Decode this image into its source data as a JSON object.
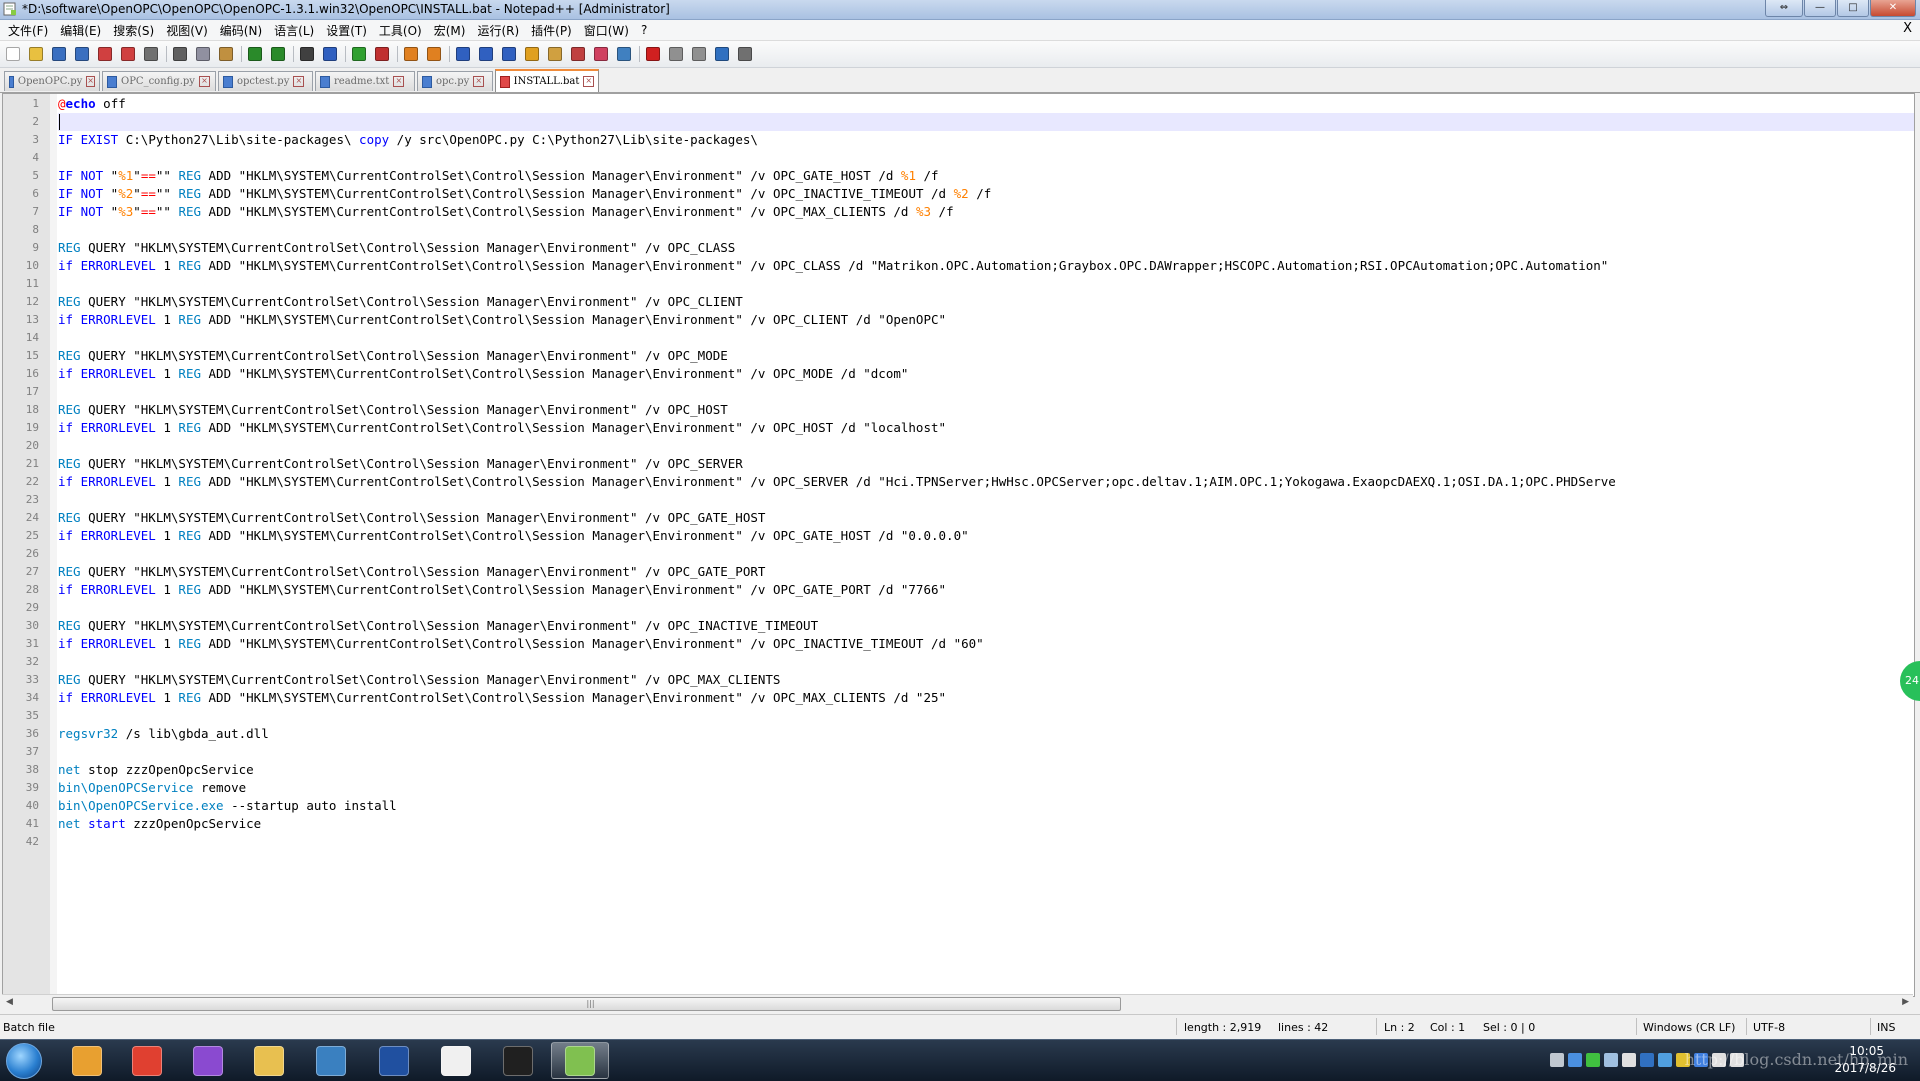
{
  "window": {
    "title": "*D:\\software\\OpenOPC\\OpenOPC\\OpenOPC-1.3.1.win32\\OpenOPC\\INSTALL.bat - Notepad++ [Administrator]",
    "app_icon": "notepad-plus-plus-icon",
    "controls": {
      "extra": "⇔",
      "minimize": "—",
      "maximize": "□",
      "close": "✕"
    }
  },
  "menu": {
    "items": [
      "文件(F)",
      "编辑(E)",
      "搜索(S)",
      "视图(V)",
      "编码(N)",
      "语言(L)",
      "设置(T)",
      "工具(O)",
      "宏(M)",
      "运行(R)",
      "插件(P)",
      "窗口(W)",
      "?"
    ],
    "close": "X"
  },
  "toolbar": {
    "buttons": [
      {
        "name": "new-file-icon",
        "color": "#ffffff"
      },
      {
        "name": "open-file-icon",
        "color": "#e8c040"
      },
      {
        "name": "save-icon",
        "color": "#3a6fc0"
      },
      {
        "name": "save-all-icon",
        "color": "#3a6fc0"
      },
      {
        "name": "close-icon",
        "color": "#d04040"
      },
      {
        "name": "close-all-icon",
        "color": "#d04040"
      },
      {
        "name": "print-icon",
        "color": "#707070"
      },
      {
        "name": "cut-icon",
        "color": "#606060"
      },
      {
        "name": "copy-icon",
        "color": "#9090a0"
      },
      {
        "name": "paste-icon",
        "color": "#c09040"
      },
      {
        "name": "undo-icon",
        "color": "#2a8a2a"
      },
      {
        "name": "redo-icon",
        "color": "#2a8a2a"
      },
      {
        "name": "find-icon",
        "color": "#404040"
      },
      {
        "name": "replace-icon",
        "color": "#3060c0"
      },
      {
        "name": "zoom-in-icon",
        "color": "#30a030"
      },
      {
        "name": "zoom-out-icon",
        "color": "#c03030"
      },
      {
        "name": "sync-vertical-icon",
        "color": "#e08020"
      },
      {
        "name": "sync-horizontal-icon",
        "color": "#e08020"
      },
      {
        "name": "word-wrap-icon",
        "color": "#3060c0"
      },
      {
        "name": "show-all-chars-icon",
        "color": "#3060c0"
      },
      {
        "name": "indent-guide-icon",
        "color": "#3060c0"
      },
      {
        "name": "user-language-icon",
        "color": "#e0a020"
      },
      {
        "name": "document-map-icon",
        "color": "#d0a040"
      },
      {
        "name": "function-list-icon",
        "color": "#c04040"
      },
      {
        "name": "folder-workspace-icon",
        "color": "#d04060"
      },
      {
        "name": "monitoring-icon",
        "color": "#4080c0"
      },
      {
        "name": "record-macro-icon",
        "color": "#d02020"
      },
      {
        "name": "stop-macro-icon",
        "color": "#909090"
      },
      {
        "name": "play-macro-icon",
        "color": "#909090"
      },
      {
        "name": "play-macro-multiple-icon",
        "color": "#3070c0"
      },
      {
        "name": "save-macro-icon",
        "color": "#707070"
      }
    ]
  },
  "tabs": [
    {
      "label": "OpenOPC.py",
      "active": false
    },
    {
      "label": "OPC_config.py",
      "active": false
    },
    {
      "label": "opctest.py",
      "active": false
    },
    {
      "label": "readme.txt",
      "active": false
    },
    {
      "label": "opc.py",
      "active": false
    },
    {
      "label": "INSTALL.bat",
      "active": true
    }
  ],
  "editor": {
    "current_line": 2,
    "lines": [
      [
        [
          "o",
          "@"
        ],
        [
          "kb",
          "echo"
        ],
        [
          "n",
          " off"
        ]
      ],
      [],
      [
        [
          "k",
          "IF EXIST"
        ],
        [
          "n",
          " C:\\Python27\\Lib\\site-packages\\ "
        ],
        [
          "k",
          "copy"
        ],
        [
          "n",
          " /y src\\OpenOPC.py C:\\Python27\\Lib\\site-packages\\"
        ]
      ],
      [],
      [
        [
          "k",
          "IF NOT"
        ],
        [
          "n",
          " \""
        ],
        [
          "v",
          "%1"
        ],
        [
          "n",
          "\""
        ],
        [
          "o",
          "=="
        ],
        [
          "n",
          "\"\" "
        ],
        [
          "c",
          "REG"
        ],
        [
          "n",
          " ADD \"HKLM\\SYSTEM\\CurrentControlSet\\Control\\Session Manager\\Environment\" /v OPC_GATE_HOST /d "
        ],
        [
          "v",
          "%1"
        ],
        [
          "n",
          " /f"
        ]
      ],
      [
        [
          "k",
          "IF NOT"
        ],
        [
          "n",
          " \""
        ],
        [
          "v",
          "%2"
        ],
        [
          "n",
          "\""
        ],
        [
          "o",
          "=="
        ],
        [
          "n",
          "\"\" "
        ],
        [
          "c",
          "REG"
        ],
        [
          "n",
          " ADD \"HKLM\\SYSTEM\\CurrentControlSet\\Control\\Session Manager\\Environment\" /v OPC_INACTIVE_TIMEOUT /d "
        ],
        [
          "v",
          "%2"
        ],
        [
          "n",
          " /f"
        ]
      ],
      [
        [
          "k",
          "IF NOT"
        ],
        [
          "n",
          " \""
        ],
        [
          "v",
          "%3"
        ],
        [
          "n",
          "\""
        ],
        [
          "o",
          "=="
        ],
        [
          "n",
          "\"\" "
        ],
        [
          "c",
          "REG"
        ],
        [
          "n",
          " ADD \"HKLM\\SYSTEM\\CurrentControlSet\\Control\\Session Manager\\Environment\" /v OPC_MAX_CLIENTS /d "
        ],
        [
          "v",
          "%3"
        ],
        [
          "n",
          " /f"
        ]
      ],
      [],
      [
        [
          "c",
          "REG"
        ],
        [
          "n",
          " QUERY \"HKLM\\SYSTEM\\CurrentControlSet\\Control\\Session Manager\\Environment\" /v OPC_CLASS"
        ]
      ],
      [
        [
          "k",
          "if ERRORLEVEL"
        ],
        [
          "n",
          " 1 "
        ],
        [
          "c",
          "REG"
        ],
        [
          "n",
          " ADD \"HKLM\\SYSTEM\\CurrentControlSet\\Control\\Session Manager\\Environment\" /v OPC_CLASS /d \"Matrikon.OPC.Automation;Graybox.OPC.DAWrapper;HSCOPC.Automation;RSI.OPCAutomation;OPC.Automation\""
        ]
      ],
      [],
      [
        [
          "c",
          "REG"
        ],
        [
          "n",
          " QUERY \"HKLM\\SYSTEM\\CurrentControlSet\\Control\\Session Manager\\Environment\" /v OPC_CLIENT"
        ]
      ],
      [
        [
          "k",
          "if ERRORLEVEL"
        ],
        [
          "n",
          " 1 "
        ],
        [
          "c",
          "REG"
        ],
        [
          "n",
          " ADD \"HKLM\\SYSTEM\\CurrentControlSet\\Control\\Session Manager\\Environment\" /v OPC_CLIENT /d \"OpenOPC\""
        ]
      ],
      [],
      [
        [
          "c",
          "REG"
        ],
        [
          "n",
          " QUERY \"HKLM\\SYSTEM\\CurrentControlSet\\Control\\Session Manager\\Environment\" /v OPC_MODE"
        ]
      ],
      [
        [
          "k",
          "if ERRORLEVEL"
        ],
        [
          "n",
          " 1 "
        ],
        [
          "c",
          "REG"
        ],
        [
          "n",
          " ADD \"HKLM\\SYSTEM\\CurrentControlSet\\Control\\Session Manager\\Environment\" /v OPC_MODE /d \"dcom\""
        ]
      ],
      [],
      [
        [
          "c",
          "REG"
        ],
        [
          "n",
          " QUERY \"HKLM\\SYSTEM\\CurrentControlSet\\Control\\Session Manager\\Environment\" /v OPC_HOST"
        ]
      ],
      [
        [
          "k",
          "if ERRORLEVEL"
        ],
        [
          "n",
          " 1 "
        ],
        [
          "c",
          "REG"
        ],
        [
          "n",
          " ADD \"HKLM\\SYSTEM\\CurrentControlSet\\Control\\Session Manager\\Environment\" /v OPC_HOST /d \"localhost\""
        ]
      ],
      [],
      [
        [
          "c",
          "REG"
        ],
        [
          "n",
          " QUERY \"HKLM\\SYSTEM\\CurrentControlSet\\Control\\Session Manager\\Environment\" /v OPC_SERVER"
        ]
      ],
      [
        [
          "k",
          "if ERRORLEVEL"
        ],
        [
          "n",
          " 1 "
        ],
        [
          "c",
          "REG"
        ],
        [
          "n",
          " ADD \"HKLM\\SYSTEM\\CurrentControlSet\\Control\\Session Manager\\Environment\" /v OPC_SERVER /d \"Hci.TPNServer;HwHsc.OPCServer;opc.deltav.1;AIM.OPC.1;Yokogawa.ExaopcDAEXQ.1;OSI.DA.1;OPC.PHDServe"
        ]
      ],
      [],
      [
        [
          "c",
          "REG"
        ],
        [
          "n",
          " QUERY \"HKLM\\SYSTEM\\CurrentControlSet\\Control\\Session Manager\\Environment\" /v OPC_GATE_HOST"
        ]
      ],
      [
        [
          "k",
          "if ERRORLEVEL"
        ],
        [
          "n",
          " 1 "
        ],
        [
          "c",
          "REG"
        ],
        [
          "n",
          " ADD \"HKLM\\SYSTEM\\CurrentControlSet\\Control\\Session Manager\\Environment\" /v OPC_GATE_HOST /d \"0.0.0.0\""
        ]
      ],
      [],
      [
        [
          "c",
          "REG"
        ],
        [
          "n",
          " QUERY \"HKLM\\SYSTEM\\CurrentControlSet\\Control\\Session Manager\\Environment\" /v OPC_GATE_PORT"
        ]
      ],
      [
        [
          "k",
          "if ERRORLEVEL"
        ],
        [
          "n",
          " 1 "
        ],
        [
          "c",
          "REG"
        ],
        [
          "n",
          " ADD \"HKLM\\SYSTEM\\CurrentControlSet\\Control\\Session Manager\\Environment\" /v OPC_GATE_PORT /d \"7766\""
        ]
      ],
      [],
      [
        [
          "c",
          "REG"
        ],
        [
          "n",
          " QUERY \"HKLM\\SYSTEM\\CurrentControlSet\\Control\\Session Manager\\Environment\" /v OPC_INACTIVE_TIMEOUT"
        ]
      ],
      [
        [
          "k",
          "if ERRORLEVEL"
        ],
        [
          "n",
          " 1 "
        ],
        [
          "c",
          "REG"
        ],
        [
          "n",
          " ADD \"HKLM\\SYSTEM\\CurrentControlSet\\Control\\Session Manager\\Environment\" /v OPC_INACTIVE_TIMEOUT /d \"60\""
        ]
      ],
      [],
      [
        [
          "c",
          "REG"
        ],
        [
          "n",
          " QUERY \"HKLM\\SYSTEM\\CurrentControlSet\\Control\\Session Manager\\Environment\" /v OPC_MAX_CLIENTS"
        ]
      ],
      [
        [
          "k",
          "if ERRORLEVEL"
        ],
        [
          "n",
          " 1 "
        ],
        [
          "c",
          "REG"
        ],
        [
          "n",
          " ADD \"HKLM\\SYSTEM\\CurrentControlSet\\Control\\Session Manager\\Environment\" /v OPC_MAX_CLIENTS /d \"25\""
        ]
      ],
      [],
      [
        [
          "c",
          "regsvr32"
        ],
        [
          "n",
          " /s lib\\gbda_aut.dll"
        ]
      ],
      [],
      [
        [
          "c",
          "net"
        ],
        [
          "n",
          " stop zzzOpenOpcService"
        ]
      ],
      [
        [
          "c",
          "bin\\OpenOPCService"
        ],
        [
          "n",
          " remove"
        ]
      ],
      [
        [
          "c",
          "bin\\OpenOPCService.exe"
        ],
        [
          "n",
          " --startup auto install"
        ]
      ],
      [
        [
          "c",
          "net"
        ],
        [
          "n",
          " "
        ],
        [
          "k",
          "start"
        ],
        [
          "n",
          " zzzOpenOpcService"
        ]
      ],
      []
    ]
  },
  "scrollbar": {
    "left_arrow": "◀",
    "right_arrow": "▶",
    "grip": "|||"
  },
  "status": {
    "file_type": "Batch file",
    "length": "length : 2,919",
    "lines": "lines : 42",
    "ln": "Ln : 2",
    "col": "Col : 1",
    "sel": "Sel : 0 | 0",
    "eol": "Windows (CR LF)",
    "encoding": "UTF-8",
    "mode": "INS"
  },
  "side_badge": "24",
  "taskbar": {
    "apps": [
      {
        "name": "start-orb"
      },
      {
        "name": "windows-live-icon",
        "color": "#e8a030"
      },
      {
        "name": "chrome-icon",
        "color": "#e04030"
      },
      {
        "name": "visual-studio-icon",
        "color": "#8a4ad0"
      },
      {
        "name": "file-explorer-icon",
        "color": "#e8c050"
      },
      {
        "name": "oscilloscope-app-icon",
        "color": "#3a80c0"
      },
      {
        "name": "signal-app-icon",
        "color": "#2050a0"
      },
      {
        "name": "ipython-icon",
        "color": "#f0f0f0"
      },
      {
        "name": "command-prompt-icon",
        "color": "#202020"
      },
      {
        "name": "notepad-plus-plus-icon",
        "color": "#80c050"
      }
    ],
    "tray_icons": [
      {
        "name": "keyboard-icon",
        "color": "#c0c8d0"
      },
      {
        "name": "help-icon",
        "color": "#4a90e0"
      },
      {
        "name": "wechat-icon",
        "color": "#40c040"
      },
      {
        "name": "network-icon",
        "color": "#a0c0e0"
      },
      {
        "name": "flag-icon",
        "color": "#e0e0e0"
      },
      {
        "name": "app-tray-icon",
        "color": "#3070c0"
      },
      {
        "name": "display-icon",
        "color": "#50a0e0"
      },
      {
        "name": "qq-icon",
        "color": "#e0c030"
      },
      {
        "name": "bluetooth-icon",
        "color": "#4080e0"
      },
      {
        "name": "signal-bars-icon",
        "color": "#e0e0e0"
      },
      {
        "name": "volume-icon",
        "color": "#e0e0e0"
      }
    ],
    "clock_time": "10:05",
    "clock_date": "2017/8/26",
    "watermark": "http://blog.csdn.net/hp_min"
  }
}
